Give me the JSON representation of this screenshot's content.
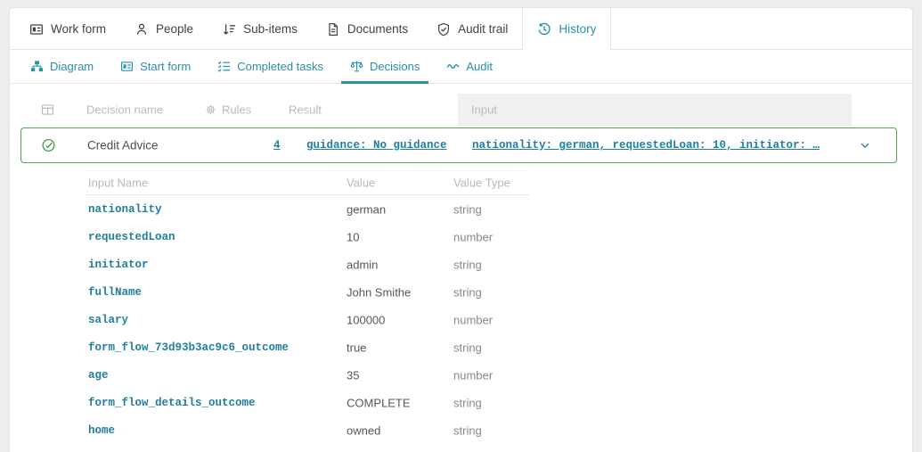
{
  "colors": {
    "accent_teal": "#2a93af",
    "link_teal": "#1e7f9e",
    "success_green": "#43a047",
    "input_header_bg": "#f0f0f0"
  },
  "tabbar": {
    "tabs": [
      {
        "label": "Work form",
        "icon": "work-form-icon",
        "active": false
      },
      {
        "label": "People",
        "icon": "person-icon",
        "active": false
      },
      {
        "label": "Sub-items",
        "icon": "sort-desc-icon",
        "active": false
      },
      {
        "label": "Documents",
        "icon": "document-icon",
        "active": false
      },
      {
        "label": "Audit trail",
        "icon": "shield-check-icon",
        "active": false
      },
      {
        "label": "History",
        "icon": "history-icon",
        "active": true
      }
    ]
  },
  "subtabbar": {
    "tabs": [
      {
        "label": "Diagram",
        "icon": "diagram-icon",
        "active": false
      },
      {
        "label": "Start form",
        "icon": "form-icon",
        "active": false
      },
      {
        "label": "Completed tasks",
        "icon": "checklist-icon",
        "active": false
      },
      {
        "label": "Decisions",
        "icon": "scale-icon",
        "active": true
      },
      {
        "label": "Audit",
        "icon": "pulse-icon",
        "active": false
      }
    ]
  },
  "decisions": {
    "columns": {
      "decision_name": "Decision name",
      "rules": "Rules",
      "result": "Result",
      "input": "Input"
    },
    "row": {
      "status": "success",
      "name": "Credit Advice",
      "rules_count": "4",
      "result": "guidance: No guidance",
      "input_preview": "nationality: german, requestedLoan: 10, initiator: …"
    }
  },
  "input_details": {
    "columns": {
      "name": "Input Name",
      "value": "Value",
      "type": "Value Type"
    },
    "rows": [
      {
        "name": "nationality",
        "value": "german",
        "type": "string"
      },
      {
        "name": "requestedLoan",
        "value": "10",
        "type": "number"
      },
      {
        "name": "initiator",
        "value": "admin",
        "type": "string"
      },
      {
        "name": "fullName",
        "value": "John Smithe",
        "type": "string"
      },
      {
        "name": "salary",
        "value": "100000",
        "type": "number"
      },
      {
        "name": "form_flow_73d93b3ac9c6_outcome",
        "value": "true",
        "type": "string"
      },
      {
        "name": "age",
        "value": "35",
        "type": "number"
      },
      {
        "name": "form_flow_details_outcome",
        "value": "COMPLETE",
        "type": "string"
      },
      {
        "name": "home",
        "value": "owned",
        "type": "string"
      }
    ]
  }
}
